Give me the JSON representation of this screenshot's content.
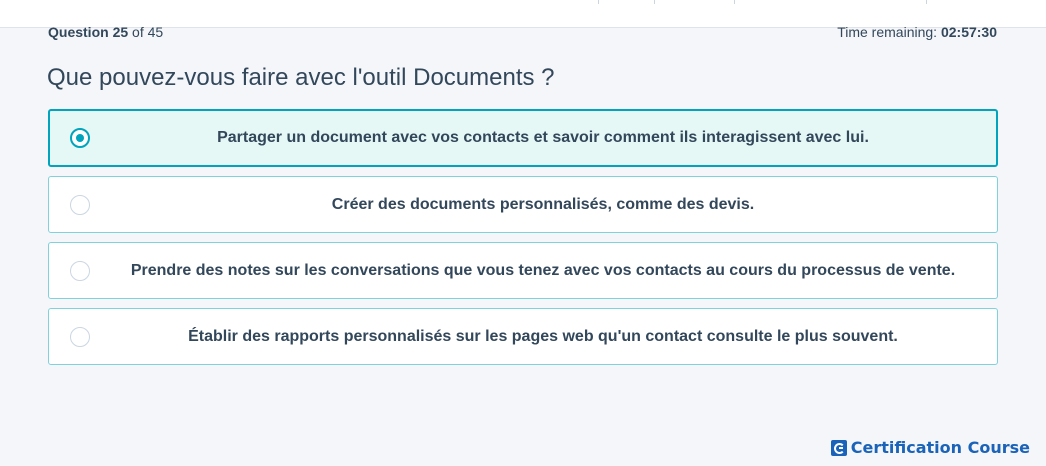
{
  "progress": {
    "label": "Question",
    "current": "25",
    "of_label": "of",
    "total": "45"
  },
  "timer": {
    "label": "Time remaining:",
    "value": "02:57:30"
  },
  "question": {
    "text": "Que pouvez-vous faire avec l'outil Documents ?"
  },
  "options": [
    {
      "text": "Partager un document avec vos contacts et savoir comment ils interagissent avec lui.",
      "selected": true
    },
    {
      "text": "Créer des documents personnalisés, comme des devis.",
      "selected": false
    },
    {
      "text": "Prendre des notes sur les conversations que vous tenez avec vos contacts au cours du processus de vente.",
      "selected": false
    },
    {
      "text": "Établir des rapports personnalisés sur les pages web qu'un contact consulte le plus souvent.",
      "selected": false
    }
  ],
  "watermark": {
    "text": "Certification Course",
    "icon": "brand-c-icon"
  },
  "colors": {
    "accent": "#00a4bd",
    "selected_bg": "#e5f8f6",
    "text": "#33475b",
    "brand": "#1a63b8"
  }
}
